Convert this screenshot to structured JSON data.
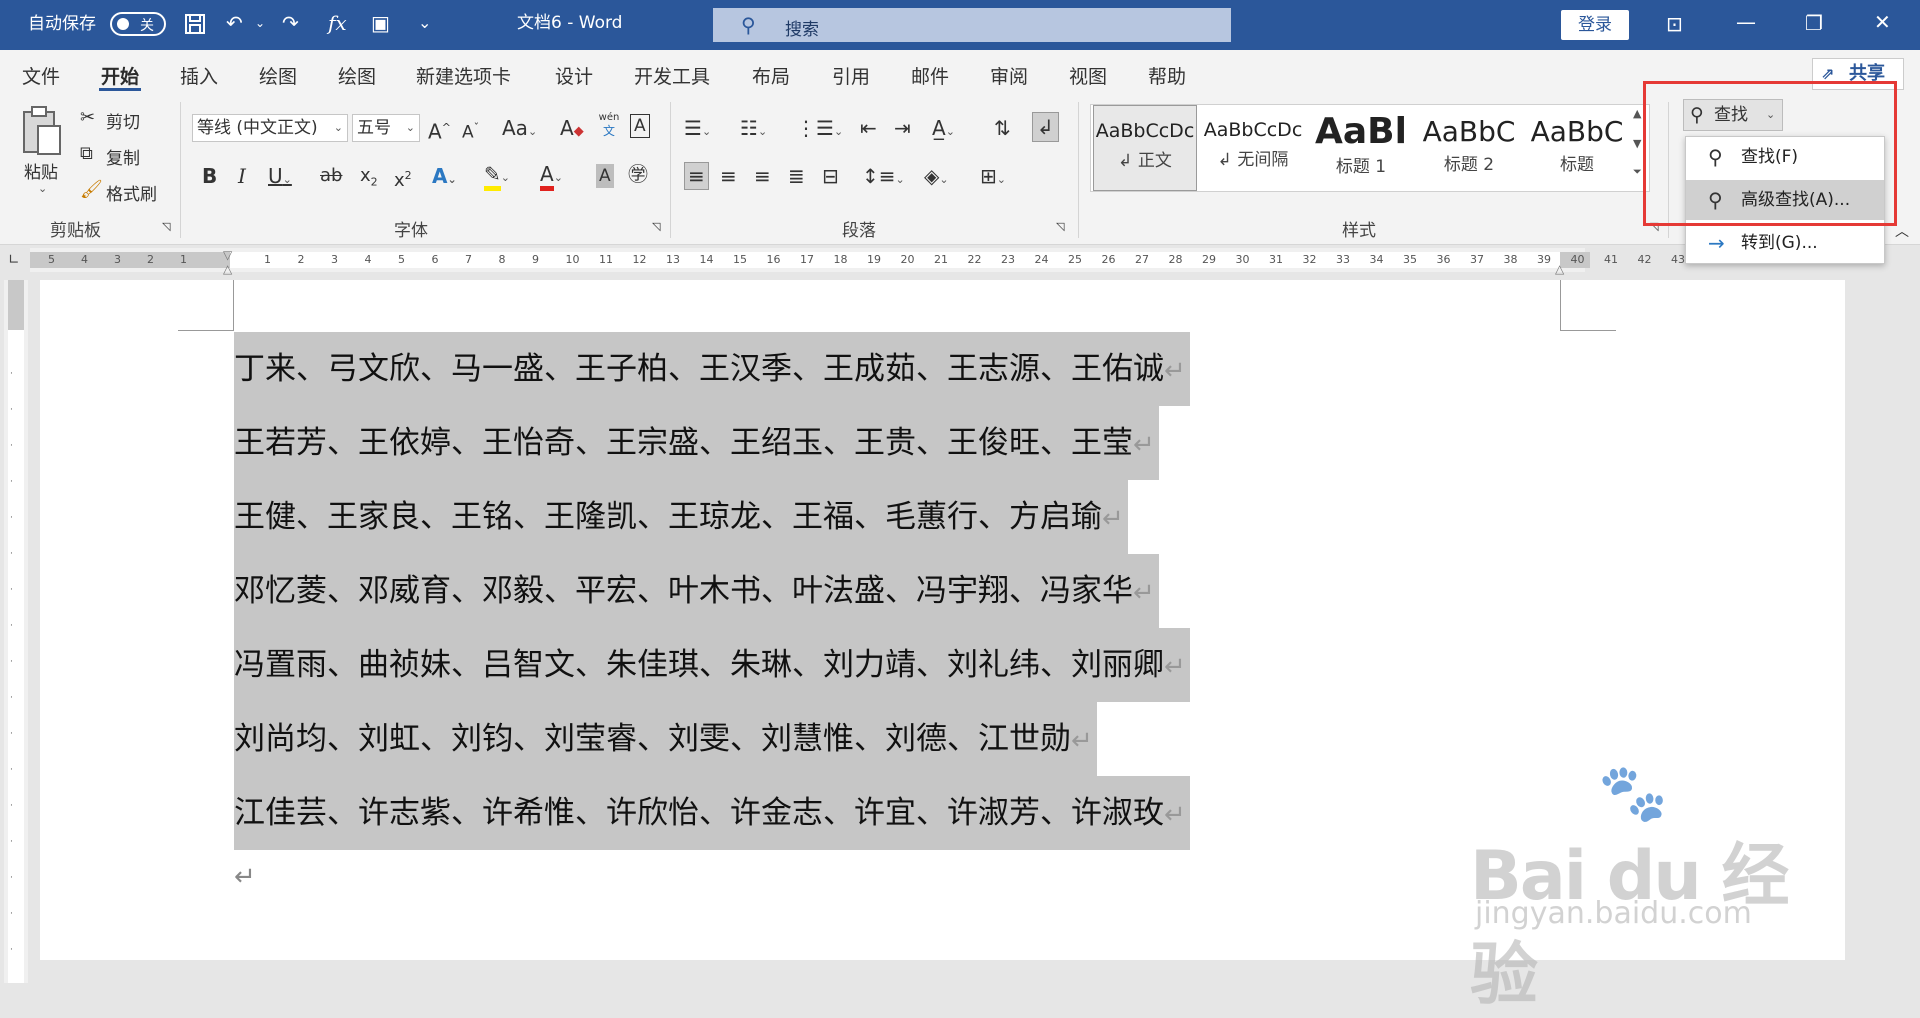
{
  "titlebar": {
    "autosave_label": "自动保存",
    "autosave_state": "关",
    "doc_title": "文档6 - Word",
    "search_placeholder": "搜索",
    "login_label": "登录",
    "colors": {
      "bar": "#2b579a",
      "search": "#b7c6e0"
    }
  },
  "tabs": [
    "文件",
    "开始",
    "插入",
    "绘图",
    "绘图",
    "新建选项卡",
    "设计",
    "开发工具",
    "布局",
    "引用",
    "邮件",
    "审阅",
    "视图",
    "帮助"
  ],
  "active_tab": "开始",
  "share_label": "共享",
  "ribbon": {
    "clipboard": {
      "paste": "粘贴",
      "cut": "剪切",
      "copy": "复制",
      "format_painter": "格式刷",
      "group": "剪贴板"
    },
    "font": {
      "font_name": "等线 (中文正文)",
      "font_size": "五号",
      "group": "字体",
      "phonetic_top": "wén",
      "phonetic_bottom": "文"
    },
    "paragraph": {
      "group": "段落"
    },
    "styles": {
      "group": "样式",
      "items": [
        {
          "sample": "AaBbCcDc",
          "name": "↲ 正文"
        },
        {
          "sample": "AaBbCcDc",
          "name": "↲ 无间隔"
        },
        {
          "sample": "AaBl",
          "name": "标题 1"
        },
        {
          "sample": "AaBbC",
          "name": "标题 2"
        },
        {
          "sample": "AaBbC",
          "name": "标题"
        }
      ]
    },
    "find": {
      "button": "查找",
      "menu": [
        {
          "icon": "search-icon",
          "label": "查找(F)"
        },
        {
          "icon": "search-icon",
          "label": "高级查找(A)..."
        },
        {
          "icon": "arrow-right-icon",
          "label": "转到(G)..."
        }
      ],
      "highlight_color": "#e53935"
    }
  },
  "ruler": {
    "left_numbers": [
      "5",
      "4",
      "3",
      "2",
      "1"
    ],
    "right_numbers": [
      "1",
      "2",
      "3",
      "4",
      "5",
      "6",
      "7",
      "8",
      "9",
      "10",
      "11",
      "12",
      "13",
      "14",
      "15",
      "16",
      "17",
      "18",
      "19",
      "20",
      "21",
      "22",
      "23",
      "24",
      "25",
      "26",
      "27",
      "28",
      "29",
      "30",
      "31",
      "32",
      "33",
      "34",
      "35",
      "36",
      "37",
      "38",
      "39",
      "40",
      "41",
      "42",
      "43"
    ]
  },
  "document": {
    "lines": [
      "丁来、弓文欣、马一盛、王子柏、王汉季、王成茹、王志源、王佑诚",
      "王若芳、王依婷、王怡奇、王宗盛、王绍玉、王贵、王俊旺、王莹",
      "王健、王家良、王铭、王隆凯、王琼龙、王福、毛蕙行、方启瑜",
      "邓忆菱、邓威育、邓毅、平宏、叶木书、叶法盛、冯宇翔、冯家华",
      "冯置雨、曲祯妹、吕智文、朱佳琪、朱琳、刘力靖、刘礼纬、刘丽卿",
      "刘尚均、刘虹、刘钧、刘莹睿、刘雯、刘慧惟、刘德、江世勋",
      "江佳芸、许志紫、许希惟、许欣怡、许金志、许宜、许淑芳、许淑玫"
    ],
    "para_mark": "↵",
    "selection_color": "#c6c6c6"
  },
  "watermark": {
    "logo": "Bai du 经验",
    "url": "jingyan.baidu.com"
  }
}
